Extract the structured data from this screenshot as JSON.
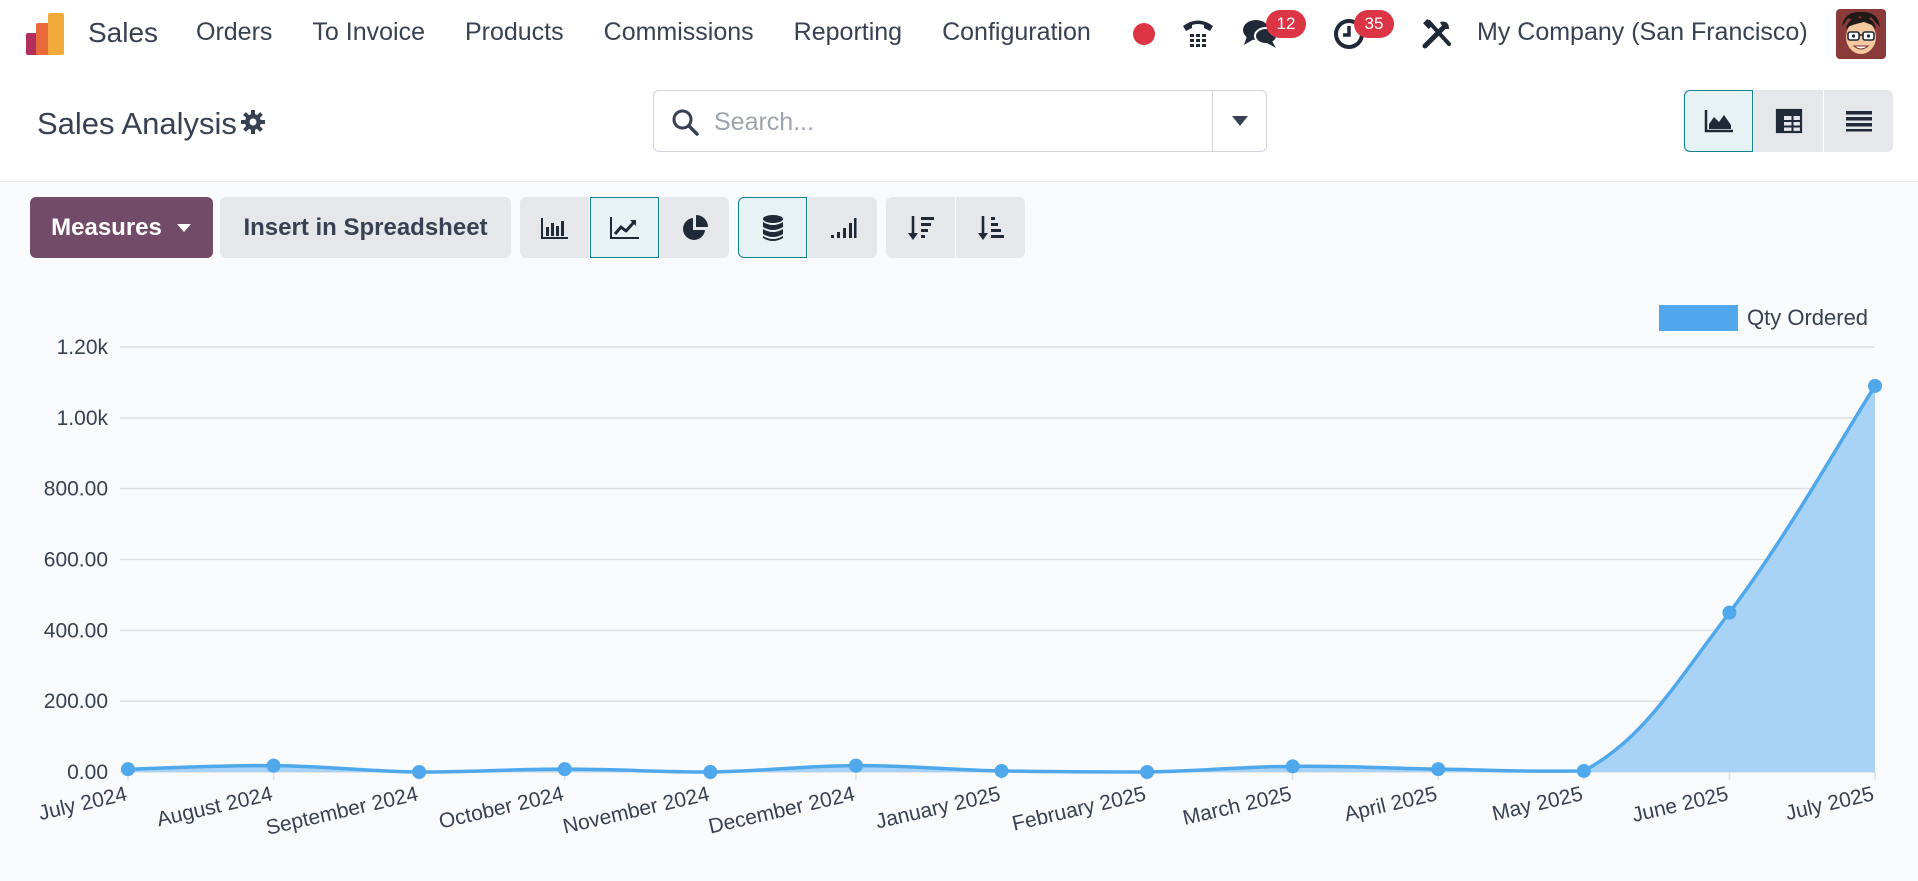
{
  "navbar": {
    "app_name": "Sales",
    "menu": [
      "Orders",
      "To Invoice",
      "Products",
      "Commissions",
      "Reporting",
      "Configuration"
    ],
    "messages_badge": "12",
    "activities_badge": "35",
    "company": "My Company (San Francisco)"
  },
  "control": {
    "title": "Sales Analysis",
    "search_placeholder": "Search...",
    "views": [
      "graph",
      "pivot",
      "list"
    ],
    "active_view": "graph"
  },
  "toolbar": {
    "measures_label": "Measures",
    "insert_label": "Insert in Spreadsheet",
    "chart_types": [
      "bar",
      "line",
      "pie"
    ],
    "active_chart_type": "line",
    "stacked_active": true
  },
  "colors": {
    "brand": "#714b67",
    "accent": "#0f8290",
    "series": "#4fa8ec",
    "series_fill": "#a9d3f6",
    "badge": "#dc3545"
  },
  "chart_data": {
    "type": "area",
    "categories": [
      "July 2024",
      "August 2024",
      "September 2024",
      "October 2024",
      "November 2024",
      "December 2024",
      "January 2025",
      "February 2025",
      "March 2025",
      "April 2025",
      "May 2025",
      "June 2025",
      "July 2025"
    ],
    "series": [
      {
        "name": "Qty Ordered",
        "values": [
          8,
          18,
          0,
          8,
          0,
          18,
          3,
          0,
          16,
          8,
          3,
          450,
          1090
        ]
      }
    ],
    "ylim": [
      0,
      1200
    ],
    "y_ticks": [
      "0.00",
      "200.00",
      "400.00",
      "600.00",
      "800.00",
      "1.00k",
      "1.20k"
    ],
    "grid": true,
    "legend_position": "top-right"
  }
}
